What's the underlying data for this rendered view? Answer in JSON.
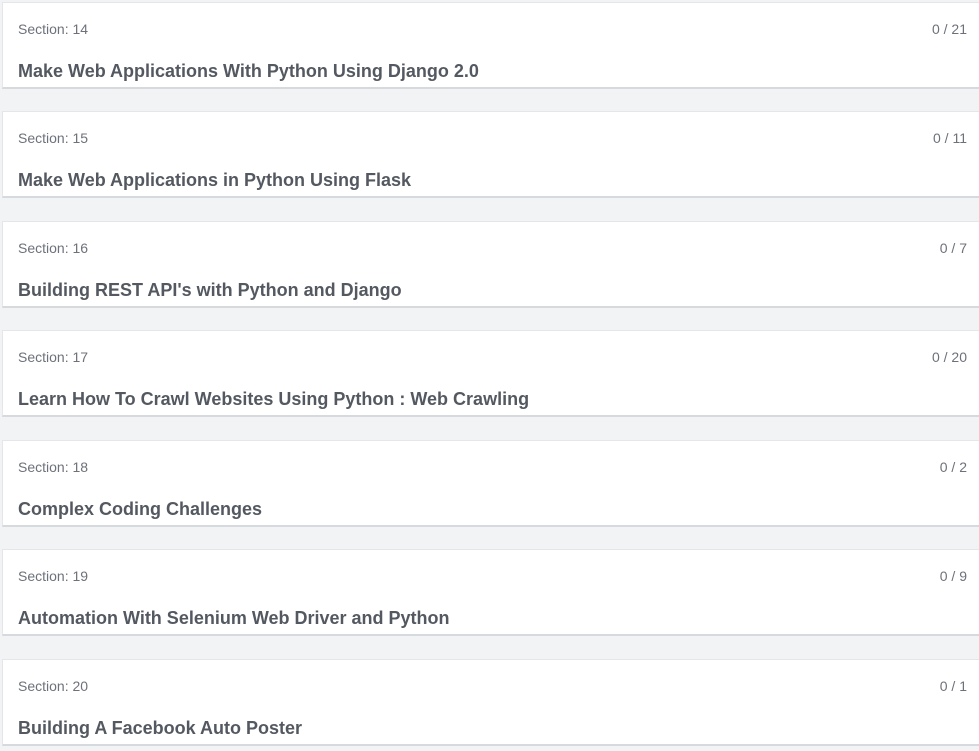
{
  "sections": [
    {
      "label": "Section: 14",
      "progress": "0 / 21",
      "title": "Make Web Applications With Python Using Django 2.0"
    },
    {
      "label": "Section: 15",
      "progress": "0 / 11",
      "title": "Make Web Applications in Python Using Flask"
    },
    {
      "label": "Section: 16",
      "progress": "0 / 7",
      "title": "Building REST API's with Python and Django"
    },
    {
      "label": "Section: 17",
      "progress": "0 / 20",
      "title": "Learn How To Crawl Websites Using Python : Web Crawling"
    },
    {
      "label": "Section: 18",
      "progress": "0 / 2",
      "title": "Complex Coding Challenges"
    },
    {
      "label": "Section: 19",
      "progress": "0 / 9",
      "title": "Automation With Selenium Web Driver and Python"
    },
    {
      "label": "Section: 20",
      "progress": "0 / 1",
      "title": "Building A Facebook Auto Poster"
    }
  ]
}
